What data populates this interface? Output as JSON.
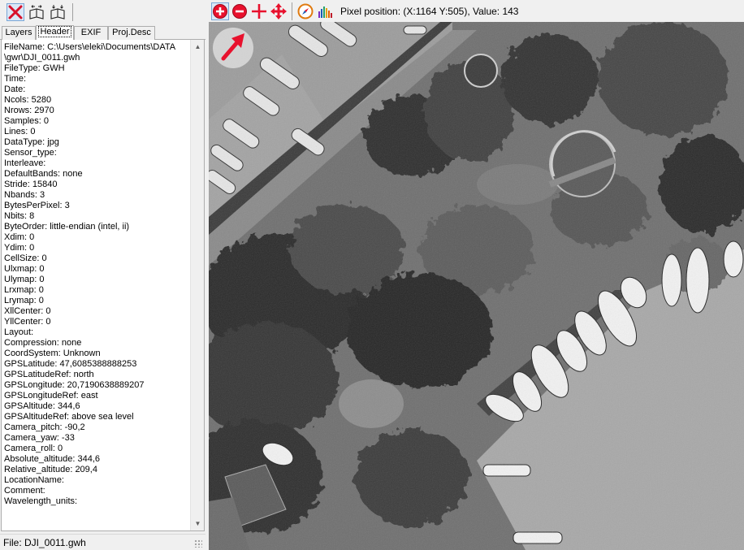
{
  "left_toolbar": {
    "buttons": [
      {
        "name": "close",
        "icon": "red-x-icon",
        "active": true
      },
      {
        "name": "layers-a",
        "icon": "book-arrows-icon"
      },
      {
        "name": "layers-b",
        "icon": "book-arrow-icon"
      }
    ]
  },
  "tabs": [
    {
      "label": "Layers",
      "active": false
    },
    {
      "label": "Header",
      "active": true
    },
    {
      "label": "EXIF",
      "active": false
    },
    {
      "label": "Proj.Desc",
      "active": false
    }
  ],
  "header_lines": [
    "FileName: C:\\Users\\eleki\\Documents\\DATA",
    "\\gwr\\DJI_0011.gwh",
    "FileType: GWH",
    "Time:",
    "Date:",
    "Ncols: 5280",
    "Nrows: 2970",
    "Samples: 0",
    "Lines: 0",
    "DataType: jpg",
    "Sensor_type:",
    "Interleave:",
    "DefaultBands: none",
    "Stride: 15840",
    "Nbands: 3",
    "BytesPerPixel: 3",
    "Nbits: 8",
    "ByteOrder: little-endian (intel, ii)",
    "Xdim: 0",
    "Ydim: 0",
    "CellSize: 0",
    "Ulxmap: 0",
    "Ulymap: 0",
    "Lrxmap: 0",
    "Lrymap: 0",
    "XllCenter: 0",
    "YllCenter: 0",
    "Layout:",
    "Compression: none",
    "CoordSystem: Unknown",
    "GPSLatitude: 47,6085388888253",
    "GPSLatitudeRef: north",
    "GPSLongitude: 20,7190638889207",
    "GPSLongitudeRef: east",
    "GPSAltitude: 344,6",
    "GPSAltitudeRef: above sea level",
    "Camera_pitch: -90,2",
    "Camera_yaw: -33",
    "Camera_roll: 0",
    "Absolute_altitude: 344,6",
    "Relative_altitude: 209,4",
    "LocationName:",
    "Comment:",
    "Wavelength_units:"
  ],
  "status": {
    "text": "File: DJI_0011.gwh"
  },
  "image_toolbar": {
    "buttons": [
      {
        "name": "zoom-in",
        "icon": "zoom-in-icon",
        "active": true
      },
      {
        "name": "zoom-out",
        "icon": "zoom-out-icon"
      },
      {
        "name": "crosshair",
        "icon": "crosshair-icon"
      },
      {
        "name": "pan",
        "icon": "move-arrows-icon"
      },
      {
        "name": "compass",
        "icon": "compass-icon"
      },
      {
        "name": "histogram",
        "icon": "histogram-icon"
      }
    ],
    "pixel_info": "Pixel position: (X:1164 Y:505), Value: 143"
  },
  "image": {
    "description_icon": "aerial-photo",
    "north_arrow_icon": "north-arrow-icon"
  },
  "colors": {
    "accent_red": "#e8112d",
    "selected_bg": "#dbe8f7",
    "selected_border": "#7aa7d6"
  }
}
